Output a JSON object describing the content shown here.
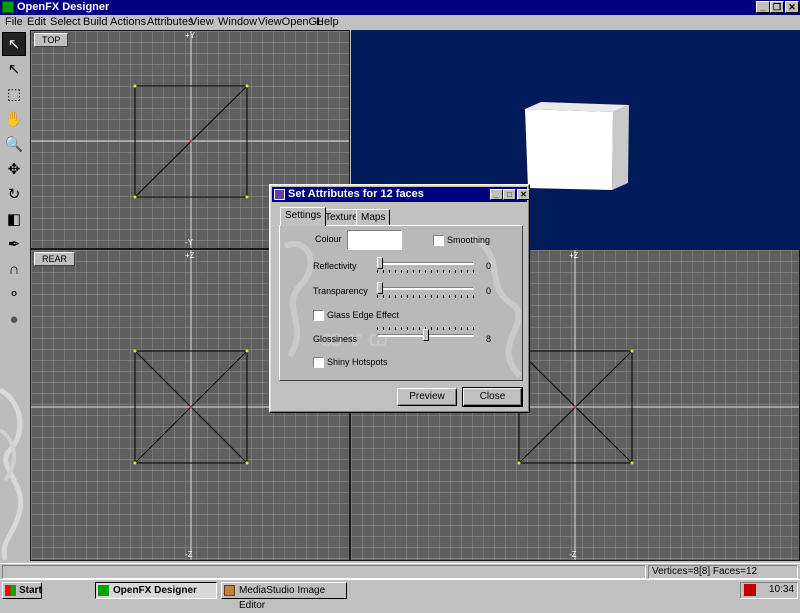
{
  "window": {
    "title": "OpenFX Designer",
    "minimize": "_",
    "restore": "❐",
    "close": "✕"
  },
  "menu": [
    {
      "label": "File"
    },
    {
      "label": "Edit"
    },
    {
      "label": "Select"
    },
    {
      "label": "Build"
    },
    {
      "label": "Actions"
    },
    {
      "label": "Attributes"
    },
    {
      "label": "View"
    },
    {
      "label": "Window"
    },
    {
      "label": "ViewOpenGL"
    },
    {
      "label": "Help"
    }
  ],
  "toolbar": {
    "tools": [
      {
        "name": "select-pointer-icon",
        "glyph": "↖"
      },
      {
        "name": "pointer-icon",
        "glyph": "↖"
      },
      {
        "name": "box-select-icon",
        "glyph": "⬚"
      },
      {
        "name": "pan-hand-icon",
        "glyph": "✋"
      },
      {
        "name": "zoom-icon",
        "glyph": "🔍"
      },
      {
        "name": "move-icon",
        "glyph": "✥"
      },
      {
        "name": "rotate-icon",
        "glyph": "↻"
      },
      {
        "name": "scale-icon",
        "glyph": "◧"
      },
      {
        "name": "pen-icon",
        "glyph": "✒"
      },
      {
        "name": "magnet-icon",
        "glyph": "∩"
      },
      {
        "name": "spheres-icon",
        "glyph": "⚬"
      },
      {
        "name": "sphere-icon",
        "glyph": "●"
      }
    ]
  },
  "viewports": {
    "top": {
      "label": "TOP",
      "axis_plus": "+Y",
      "axis_minus": "-Y"
    },
    "rear": {
      "label": "REAR",
      "axis_plus": "+Z",
      "axis_minus": "-Z"
    },
    "side": {
      "axis_plus": "+Z",
      "axis_minus": "-Z"
    }
  },
  "dialog": {
    "title": "Set Attributes for 12 faces",
    "tabs": [
      "Settings",
      "Texture",
      "Maps"
    ],
    "colour_label": "Colour",
    "smoothing_label": "Smoothing",
    "reflectivity_label": "Reflectivity",
    "reflectivity_value": "0",
    "transparency_label": "Transparency",
    "transparency_value": "0",
    "glass_label": "Glass Edge Effect",
    "glossiness_label": "Glossiness",
    "glossiness_value": "8",
    "shiny_label": "Shiny Hotspots",
    "preview_label": "Preview",
    "close_label": "Close",
    "sliders": {
      "reflectivity": 0.0,
      "transparency": 0.0,
      "glossiness": 0.5
    }
  },
  "status": {
    "counts": "Vertices=8[8] Faces=12"
  },
  "taskbar": {
    "start": "Start",
    "tasks": [
      "OpenFX Designer",
      "MediaStudio Image Editor"
    ],
    "clock": "10:34"
  },
  "colors": {
    "titlebar": "#000080",
    "viewport_bg": "#5f5f5f",
    "gl_bg": "#001a5a",
    "vertex": "#e8e800"
  }
}
